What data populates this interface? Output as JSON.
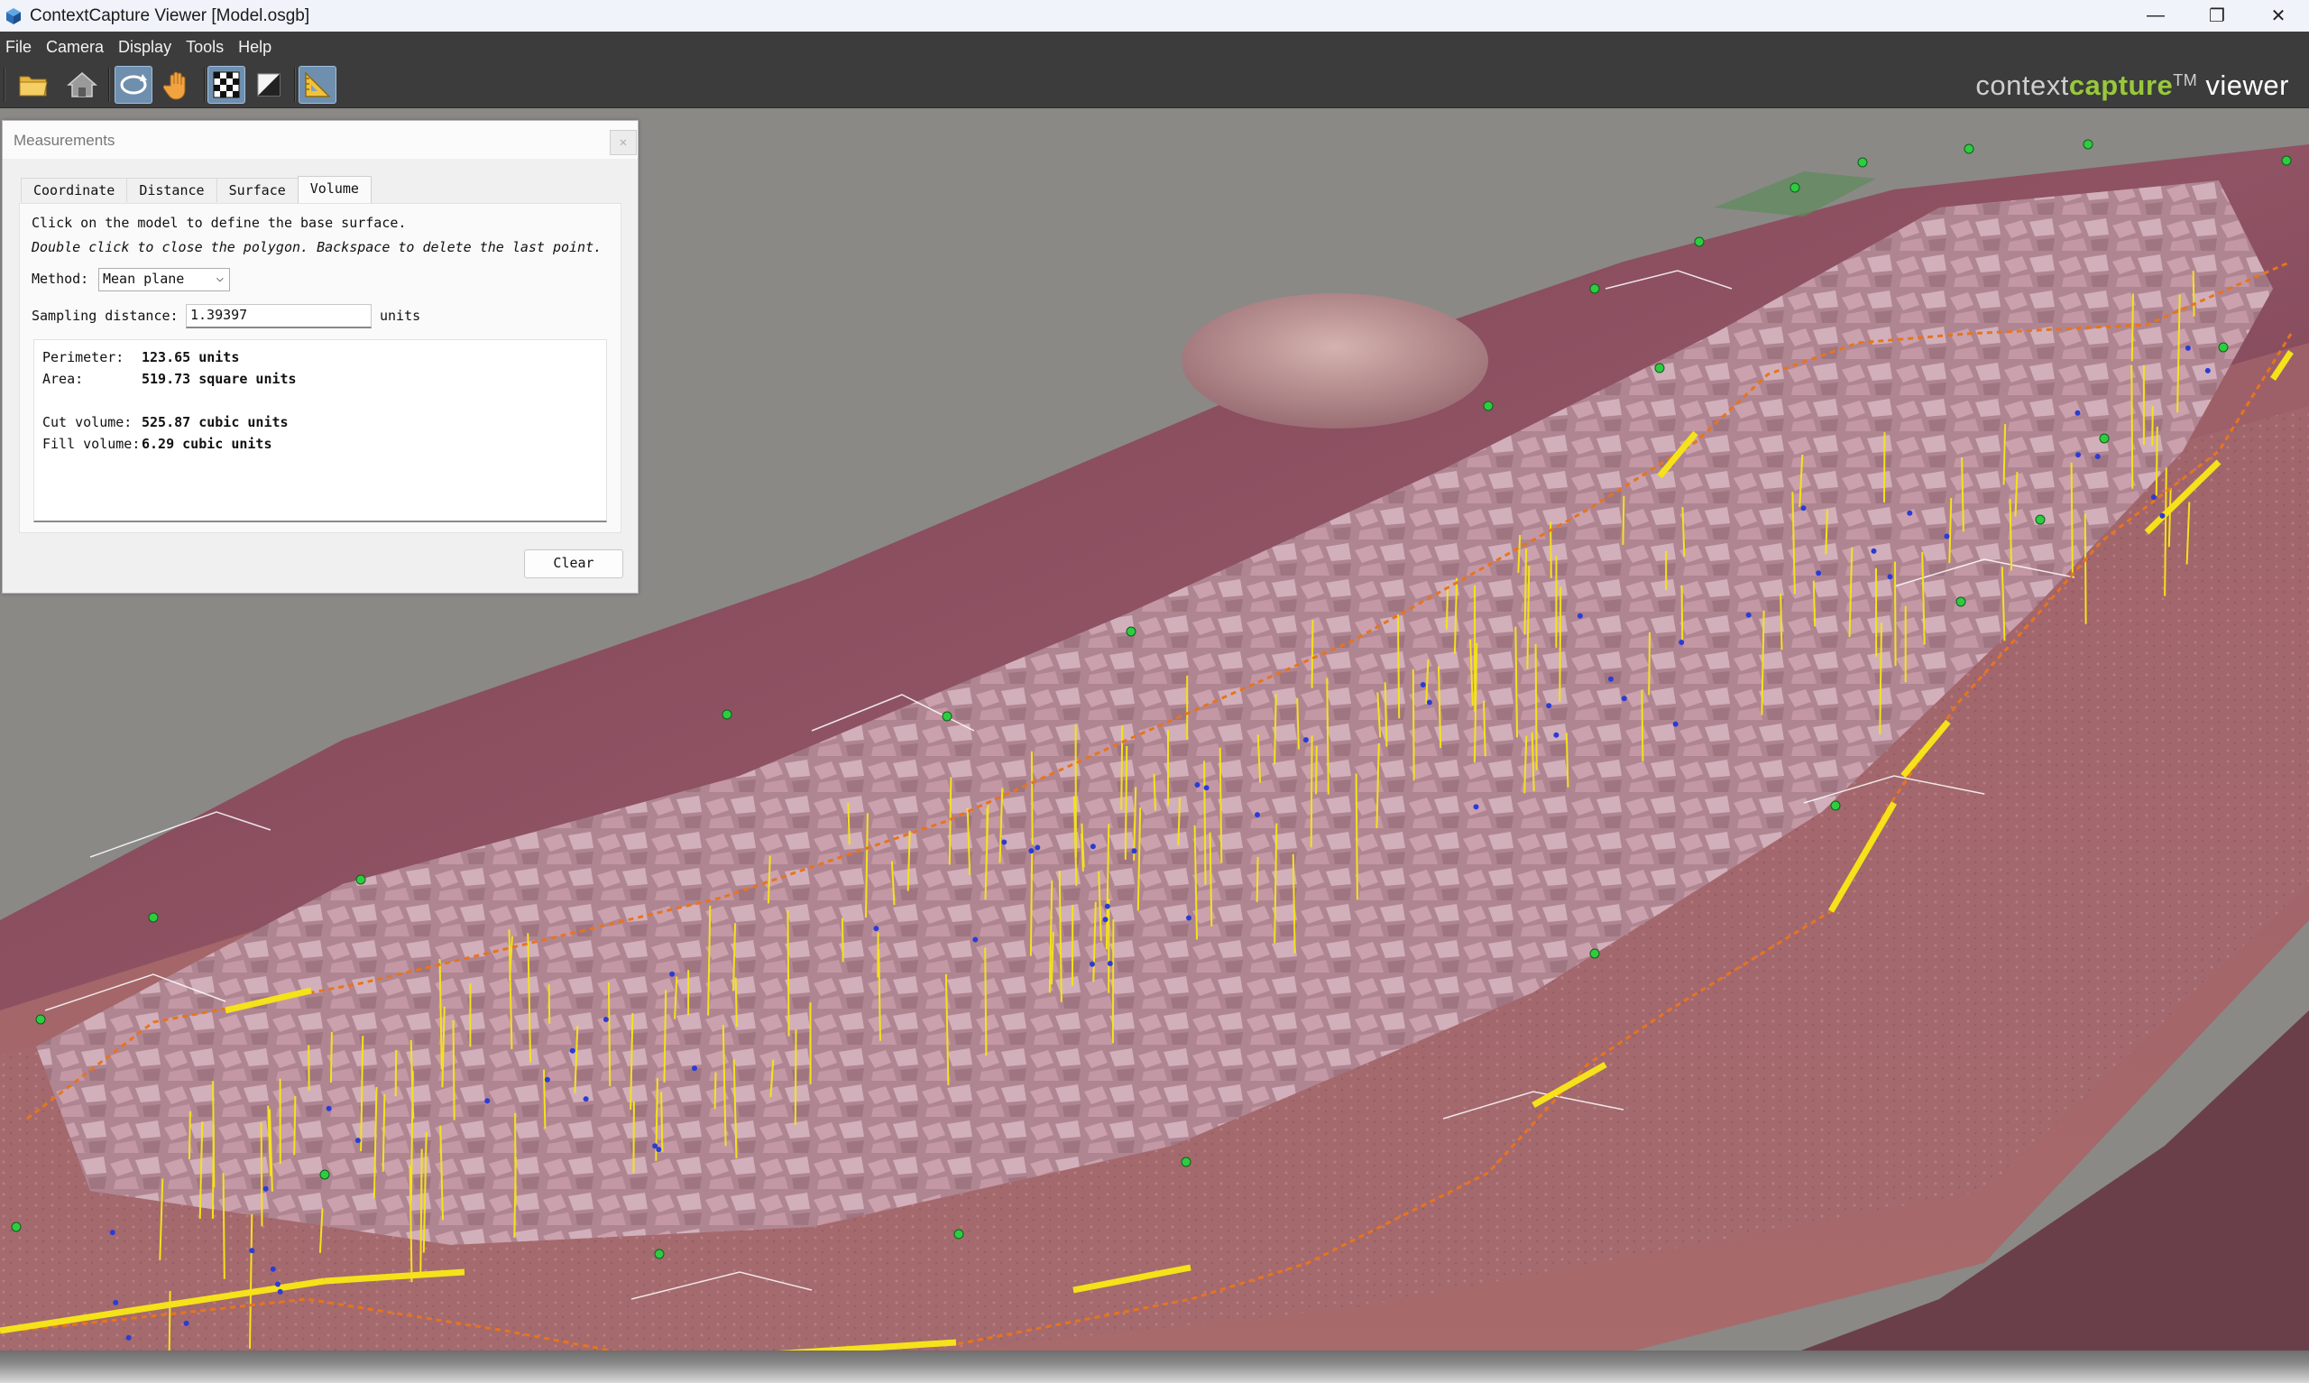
{
  "window": {
    "title": "ContextCapture Viewer [Model.osgb]",
    "app_icon": "contextcapture-cube-icon",
    "controls": {
      "minimize": "—",
      "restore": "❐",
      "close": "✕"
    }
  },
  "menu": {
    "items": [
      {
        "label": "File"
      },
      {
        "label": "Camera"
      },
      {
        "label": "Display"
      },
      {
        "label": "Tools"
      },
      {
        "label": "Help"
      }
    ]
  },
  "toolbar": {
    "buttons": [
      {
        "icon": "open-folder-icon",
        "active": false
      },
      {
        "icon": "home-icon",
        "active": false
      },
      {
        "icon": "orbit-icon",
        "active": true
      },
      {
        "icon": "pan-hand-icon",
        "active": false
      },
      {
        "icon": "checkerboard-icon",
        "active": true
      },
      {
        "icon": "light-icon",
        "active": false
      },
      {
        "icon": "measure-ruler-icon",
        "active": true
      }
    ],
    "brand": {
      "part1": "context",
      "part2": "capture",
      "tm": "TM",
      "part3": " viewer"
    },
    "brand_colors": {
      "accent": "#98c93c",
      "text": "#cfcfcf"
    }
  },
  "measurements": {
    "title": "Measurements",
    "close_label": "✕",
    "tabs": [
      {
        "label": "Coordinate",
        "selected": false
      },
      {
        "label": "Distance",
        "selected": false
      },
      {
        "label": "Surface",
        "selected": false
      },
      {
        "label": "Volume",
        "selected": true
      }
    ],
    "instructions": {
      "line1": "Click on the model to define the base surface.",
      "line2": "Double click to close the polygon. Backspace to delete the last point."
    },
    "method": {
      "label": "Method:",
      "value": "Mean plane"
    },
    "sampling": {
      "label": "Sampling distance:",
      "value": "1.39397",
      "unit": "units"
    },
    "results": {
      "perimeter": {
        "label": "Perimeter:",
        "value": "123.65 units"
      },
      "area": {
        "label": "Area:",
        "value": "519.73 square units"
      },
      "cut_volume": {
        "label": "Cut volume:",
        "value": "525.87 cubic units"
      },
      "fill_volume": {
        "label": "Fill volume:",
        "value": "6.29 cubic units"
      }
    },
    "clear_label": "Clear"
  },
  "scene": {
    "colors": {
      "sky": "#8a8986",
      "terrain": "#8a4b5c",
      "terrain_light": "#b07a86",
      "rock": "#c69aa7",
      "cut_line": "#f5e21a",
      "polygon_edge": "#e7741e",
      "vertex": "#2ecc40",
      "grid": "#ffffff"
    }
  }
}
